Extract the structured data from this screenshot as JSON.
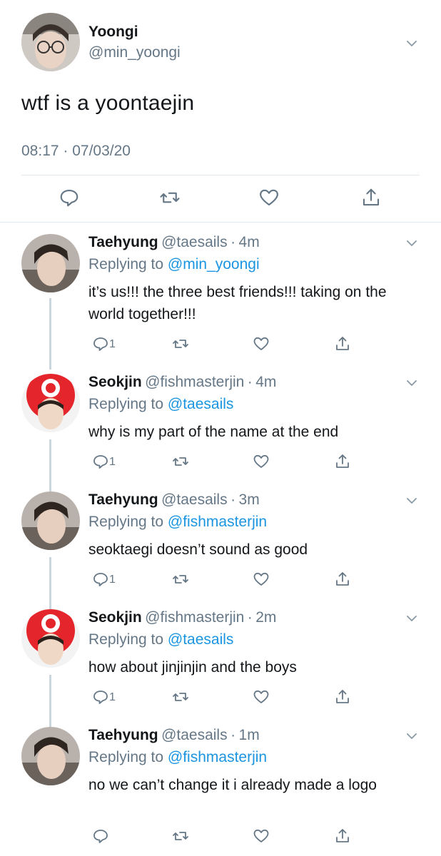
{
  "main_tweet": {
    "name": "Yoongi",
    "handle": "@min_yoongi",
    "text": "wtf is a yoontaejin",
    "timestamp": "08:17 · 07/03/20"
  },
  "replies": [
    {
      "name": "Taehyung",
      "handle": "@taesails",
      "time": "4m",
      "replying_prefix": "Replying to",
      "replying_to": "@min_yoongi",
      "text": "it’s us!!! the three best friends!!! taking on the world together!!!",
      "reply_count": "1"
    },
    {
      "name": "Seokjin",
      "handle": "@fishmasterjin",
      "time": "4m",
      "replying_prefix": "Replying to",
      "replying_to": "@taesails",
      "text": "why is my part of the name at the end",
      "reply_count": "1"
    },
    {
      "name": "Taehyung",
      "handle": "@taesails",
      "time": "3m",
      "replying_prefix": "Replying to",
      "replying_to": "@fishmasterjin",
      "text": "seoktaegi doesn’t sound as good",
      "reply_count": "1"
    },
    {
      "name": "Seokjin",
      "handle": "@fishmasterjin",
      "time": "2m",
      "replying_prefix": "Replying to",
      "replying_to": "@taesails",
      "text": "how about jinjinjin and the boys",
      "reply_count": "1"
    },
    {
      "name": "Taehyung",
      "handle": "@taesails",
      "time": "1m",
      "replying_prefix": "Replying to",
      "replying_to": "@fishmasterjin",
      "text": "no we can’t change it i already made a logo",
      "reply_count": ""
    }
  ],
  "separator": "·",
  "icons": [
    "chevron-down-icon",
    "reply-icon",
    "retweet-icon",
    "like-icon",
    "share-icon"
  ],
  "colors": {
    "link": "#1b95e0",
    "secondary": "#657786",
    "thread_line": "#ccd6dd"
  }
}
